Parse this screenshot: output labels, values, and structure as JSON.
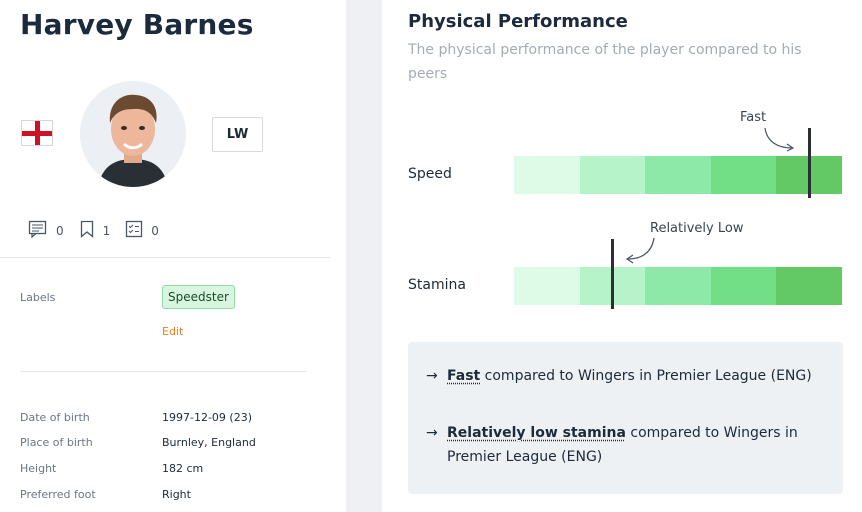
{
  "player": {
    "name": "Harvey Barnes",
    "position": "LW",
    "nationality_flag": "england-flag",
    "counts": {
      "comments": "0",
      "bookmarks": "1",
      "reports": "0"
    }
  },
  "labels_section": {
    "label": "Labels",
    "tags": [
      "Speedster"
    ],
    "edit_label": "Edit"
  },
  "details": [
    {
      "label": "Date of birth",
      "value": "1997-12-09 (23)"
    },
    {
      "label": "Place of birth",
      "value": "Burnley, England"
    },
    {
      "label": "Height",
      "value": "182 cm"
    },
    {
      "label": "Preferred foot",
      "value": "Right"
    }
  ],
  "physical": {
    "title": "Physical Performance",
    "subtitle": "The physical performance of the player compared to his peers",
    "scale_colors": [
      "#ddfbe6",
      "#b7f3c8",
      "#8ce9a7",
      "#72df87",
      "#62c964"
    ],
    "metrics": [
      {
        "name": "Speed",
        "annotation": "Fast",
        "level": 0.9
      },
      {
        "name": "Stamina",
        "annotation": "Relatively Low",
        "level": 0.3
      }
    ],
    "summary": [
      {
        "arrow": "→",
        "emphasis": "Fast",
        "rest": " compared to Wingers in Premier League (ENG)"
      },
      {
        "arrow": "→",
        "emphasis": "Relatively low stamina",
        "rest": " compared to Wingers in Premier League (ENG)"
      }
    ]
  }
}
